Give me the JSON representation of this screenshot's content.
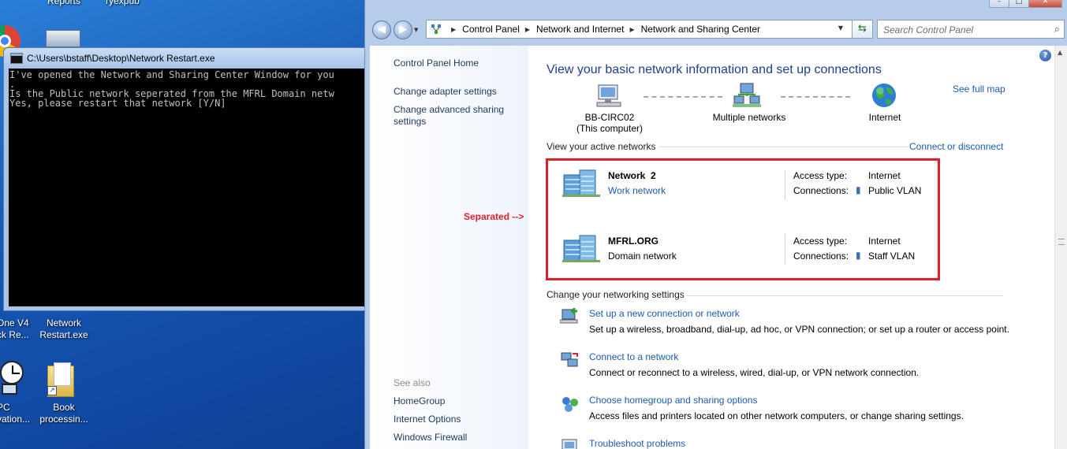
{
  "desktop": {
    "icons_top": [
      "Reports",
      "ryexpub"
    ],
    "icon_onev4": "One V4\nck Re...",
    "icon_network_restart": "Network\nRestart.exe",
    "icon_pc": "PC\nvation...",
    "icon_book": "Book\nprocessin..."
  },
  "console": {
    "title": "C:\\Users\\bstaff\\Desktop\\Network Restart.exe",
    "lines": [
      "I've opened the Network and Sharing Center Window for you",
      ".",
      "Is the Public network seperated from the MFRL Domain netw",
      "Yes, please restart that network [Y/N]"
    ]
  },
  "explorer": {
    "breadcrumb": [
      "Control Panel",
      "Network and Internet",
      "Network and Sharing Center"
    ],
    "search_placeholder": "Search Control Panel",
    "left_pane": {
      "home": "Control Panel Home",
      "links": [
        "Change adapter settings",
        "Change advanced sharing settings"
      ],
      "see_also_label": "See also",
      "see_also": [
        "HomeGroup",
        "Internet Options",
        "Windows Firewall"
      ]
    },
    "main": {
      "title": "View your basic network information and set up connections",
      "see_full_map": "See full map",
      "map": {
        "computer": "BB-CIRC02",
        "computer_sub": "(This computer)",
        "middle": "Multiple networks",
        "internet": "Internet"
      },
      "active_networks_label": "View your active networks",
      "connect_disconnect": "Connect or disconnect",
      "networks": [
        {
          "name": "Network  2",
          "type": "Work network",
          "type_is_link": true,
          "access_label": "Access type:",
          "access": "Internet",
          "conn_label": "Connections:",
          "connection": "Public VLAN"
        },
        {
          "name": "MFRL.ORG",
          "type": "Domain network",
          "type_is_link": false,
          "access_label": "Access type:",
          "access": "Internet",
          "conn_label": "Connections:",
          "connection": "Staff VLAN"
        }
      ],
      "annotation": "Separated -->",
      "settings_label": "Change your networking settings",
      "tasks": [
        {
          "title": "Set up a new connection or network",
          "desc": "Set up a wireless, broadband, dial-up, ad hoc, or VPN connection; or set up a router or access point."
        },
        {
          "title": "Connect to a network",
          "desc": "Connect or reconnect to a wireless, wired, dial-up, or VPN network connection."
        },
        {
          "title": "Choose homegroup and sharing options",
          "desc": "Access files and printers located on other network computers, or change sharing settings."
        },
        {
          "title": "Troubleshoot problems",
          "desc": ""
        }
      ]
    }
  },
  "colors": {
    "accent_link": "#1c5bb2",
    "annotation_red": "#e01f2a",
    "title_blue": "#1e3d8f"
  }
}
